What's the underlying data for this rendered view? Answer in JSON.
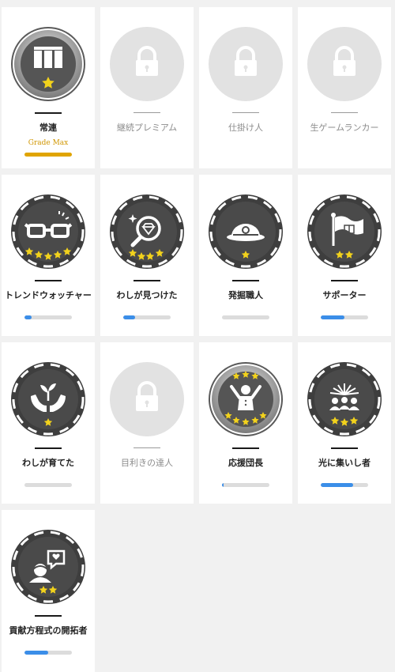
{
  "badges": [
    {
      "name": "常連",
      "state": "silver",
      "icon": "curtain-icon",
      "stars": 1,
      "grade_label": "Grade Max",
      "progress": null
    },
    {
      "name": "継続プレミアム",
      "state": "locked",
      "icon": "lock-icon",
      "stars": 0,
      "progress": null
    },
    {
      "name": "仕掛け人",
      "state": "locked",
      "icon": "lock-icon",
      "stars": 0,
      "progress": null
    },
    {
      "name": "生ゲームランカー",
      "state": "locked",
      "icon": "lock-icon",
      "stars": 0,
      "progress": null
    },
    {
      "name": "トレンドウォッチャー",
      "state": "dark",
      "icon": "glasses-icon",
      "stars": 5,
      "progress": 0.15
    },
    {
      "name": "わしが見つけた",
      "state": "dark",
      "icon": "magnifier-diamond-icon",
      "stars": 5,
      "progress": 0.25
    },
    {
      "name": "発掘職人",
      "state": "dark",
      "icon": "explorer-hat-icon",
      "stars": 1,
      "progress": 0.0
    },
    {
      "name": "サポーター",
      "state": "dark",
      "icon": "flag-icon",
      "stars": 2,
      "progress": 0.5
    },
    {
      "name": "わしが育てた",
      "state": "dark",
      "icon": "hands-sprout-icon",
      "stars": 1,
      "progress": 0.0
    },
    {
      "name": "目利きの達人",
      "state": "locked",
      "icon": "lock-icon",
      "stars": 0,
      "progress": null
    },
    {
      "name": "応援団長",
      "state": "silver",
      "icon": "cheer-leader-icon",
      "stars": 8,
      "progress": 0.04
    },
    {
      "name": "光に集いし者",
      "state": "dark",
      "icon": "crowd-light-icon",
      "stars": 3,
      "progress": 0.68
    },
    {
      "name": "貢献方程式の開拓者",
      "state": "dark",
      "icon": "chat-heart-icon",
      "stars": 2,
      "progress": 0.5
    }
  ],
  "colors": {
    "dark_badge": "#3e3e3e",
    "silver_badge": "#8a8a8a",
    "locked_badge": "#e2e2e2",
    "star": "#f2d21c",
    "progress": "#3b8ee8",
    "grade": "#e0a400"
  }
}
